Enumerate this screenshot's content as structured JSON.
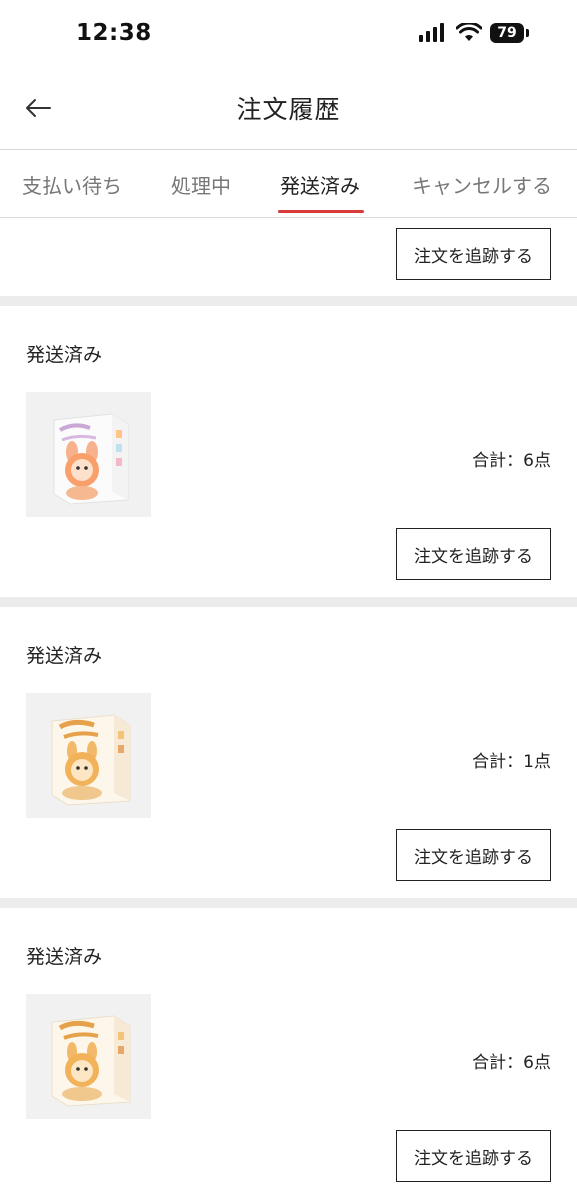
{
  "status_bar": {
    "time": "12:38",
    "battery": "79"
  },
  "header": {
    "title": "注文履歴"
  },
  "tabs": [
    {
      "label": "支払い待ち",
      "active": false
    },
    {
      "label": "処理中",
      "active": false
    },
    {
      "label": "発送済み",
      "active": true
    },
    {
      "label": "キャンセルする",
      "active": false
    }
  ],
  "partial_order": {
    "track_label": "注文を追跡する"
  },
  "orders": [
    {
      "status": "発送済み",
      "total": "合計：6点",
      "track_label": "注文を追跡する",
      "thumbnail": "product-box-orange-figure"
    },
    {
      "status": "発送済み",
      "total": "合計：1点",
      "track_label": "注文を追跡する",
      "thumbnail": "product-box-have-a-seat"
    },
    {
      "status": "発送済み",
      "total": "合計：6点",
      "track_label": "注文を追跡する",
      "thumbnail": "product-box-have-a-seat"
    }
  ],
  "colors": {
    "tab_underline": "#d93a3a",
    "separator": "#ececec"
  }
}
